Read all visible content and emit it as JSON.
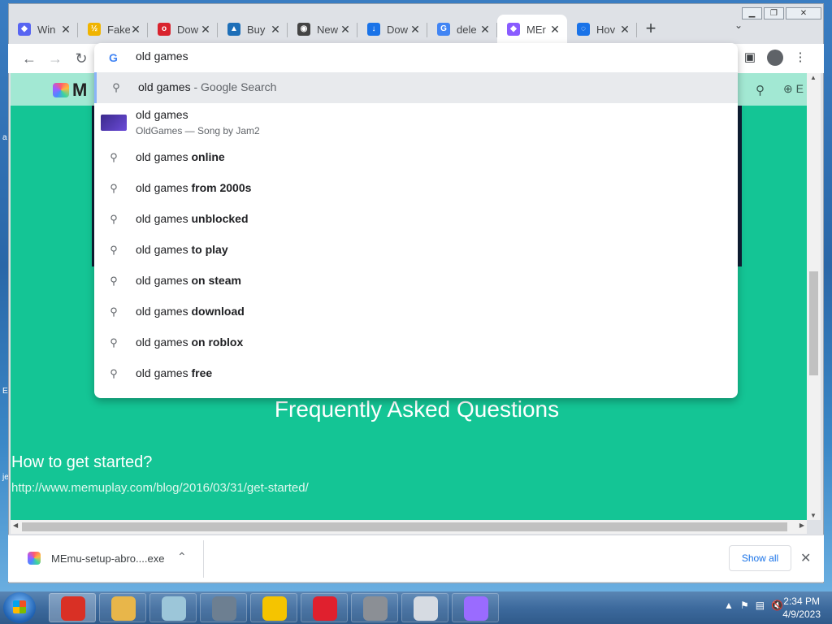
{
  "desktop": {
    "fragments": [
      "a",
      "E",
      "je"
    ]
  },
  "window": {
    "minimize": "▁",
    "restore": "❐",
    "close": "✕"
  },
  "tabs": [
    {
      "title": "Win",
      "icon_name": "discord-icon",
      "icon_color": "#5865f2",
      "glyph": "◆"
    },
    {
      "title": "Fake",
      "icon_name": "fake-name-icon",
      "icon_color": "#f0b400",
      "glyph": "½"
    },
    {
      "title": "Dow",
      "icon_name": "download-site-icon",
      "icon_color": "#d9232e",
      "glyph": "o"
    },
    {
      "title": "Buy",
      "icon_name": "buy-site-icon",
      "icon_color": "#1e6fb8",
      "glyph": "▲"
    },
    {
      "title": "New",
      "icon_name": "chrome-icon",
      "icon_color": "#444444",
      "glyph": "◉"
    },
    {
      "title": "Dow",
      "icon_name": "download-arrow-icon",
      "icon_color": "#1a73e8",
      "glyph": "↓"
    },
    {
      "title": "dele",
      "icon_name": "google-icon",
      "icon_color": "#4285f4",
      "glyph": "G"
    },
    {
      "title": "MEr",
      "icon_name": "memu-icon",
      "icon_color": "#8a5cff",
      "glyph": "◆",
      "active": true
    },
    {
      "title": "Hov",
      "icon_name": "loading-icon",
      "icon_color": "#1a73e8",
      "glyph": "◌"
    }
  ],
  "tab_close": "✕",
  "new_tab": "+",
  "tab_list": "⌄",
  "toolbar": {
    "back": "←",
    "forward": "→",
    "reload": "↻",
    "sidepanel": "▣",
    "menu": "⋮"
  },
  "omnibox": {
    "query": "old games",
    "g_glyph": "G",
    "suggestions": [
      {
        "prefix": "old games",
        "suffix": " - Google Search",
        "type": "search",
        "selected": true
      },
      {
        "title": "old games",
        "subtitle": "OldGames — Song by Jam2",
        "type": "rich"
      },
      {
        "prefix": "old games ",
        "bold": "online"
      },
      {
        "prefix": "old games ",
        "bold": "from 2000s"
      },
      {
        "prefix": "old games ",
        "bold": "unblocked"
      },
      {
        "prefix": "old games ",
        "bold": "to play"
      },
      {
        "prefix": "old games ",
        "bold": "on steam"
      },
      {
        "prefix": "old games ",
        "bold": "download"
      },
      {
        "prefix": "old games ",
        "bold": "on roblox"
      },
      {
        "prefix": "old games ",
        "bold": "free"
      }
    ],
    "search_glyph": "⚲"
  },
  "page": {
    "logo_text": "M",
    "nav_search": "⚲",
    "nav_lang": "⊕ E",
    "faq_heading": "Frequently Asked Questions",
    "faq_question": "How to get started?",
    "faq_link": "http://www.memuplay.com/blog/2016/03/31/get-started/"
  },
  "scroll": {
    "up": "▲",
    "down": "▼",
    "left": "◀",
    "right": "▶"
  },
  "downloads": {
    "file_name": "MEmu-setup-abro....exe",
    "chevron": "⌃",
    "show_all": "Show all",
    "close": "✕"
  },
  "taskbar": {
    "apps": [
      {
        "name": "chrome",
        "color": "#d93025",
        "active": true
      },
      {
        "name": "file-explorer",
        "color": "#e8b64a"
      },
      {
        "name": "notepad",
        "color": "#9cc6d9"
      },
      {
        "name": "settings",
        "color": "#6d7f91"
      },
      {
        "name": "rockstar",
        "color": "#f5c400"
      },
      {
        "name": "opera",
        "color": "#e0202e"
      },
      {
        "name": "firewall",
        "color": "#8b8f95"
      },
      {
        "name": "control-panel",
        "color": "#d6dbe2"
      },
      {
        "name": "memu",
        "color": "#9a6bff"
      }
    ],
    "tray_icons": [
      "▲",
      "⚑",
      "▤",
      "🔇"
    ],
    "time": "2:34 PM",
    "date": "4/9/2023"
  }
}
